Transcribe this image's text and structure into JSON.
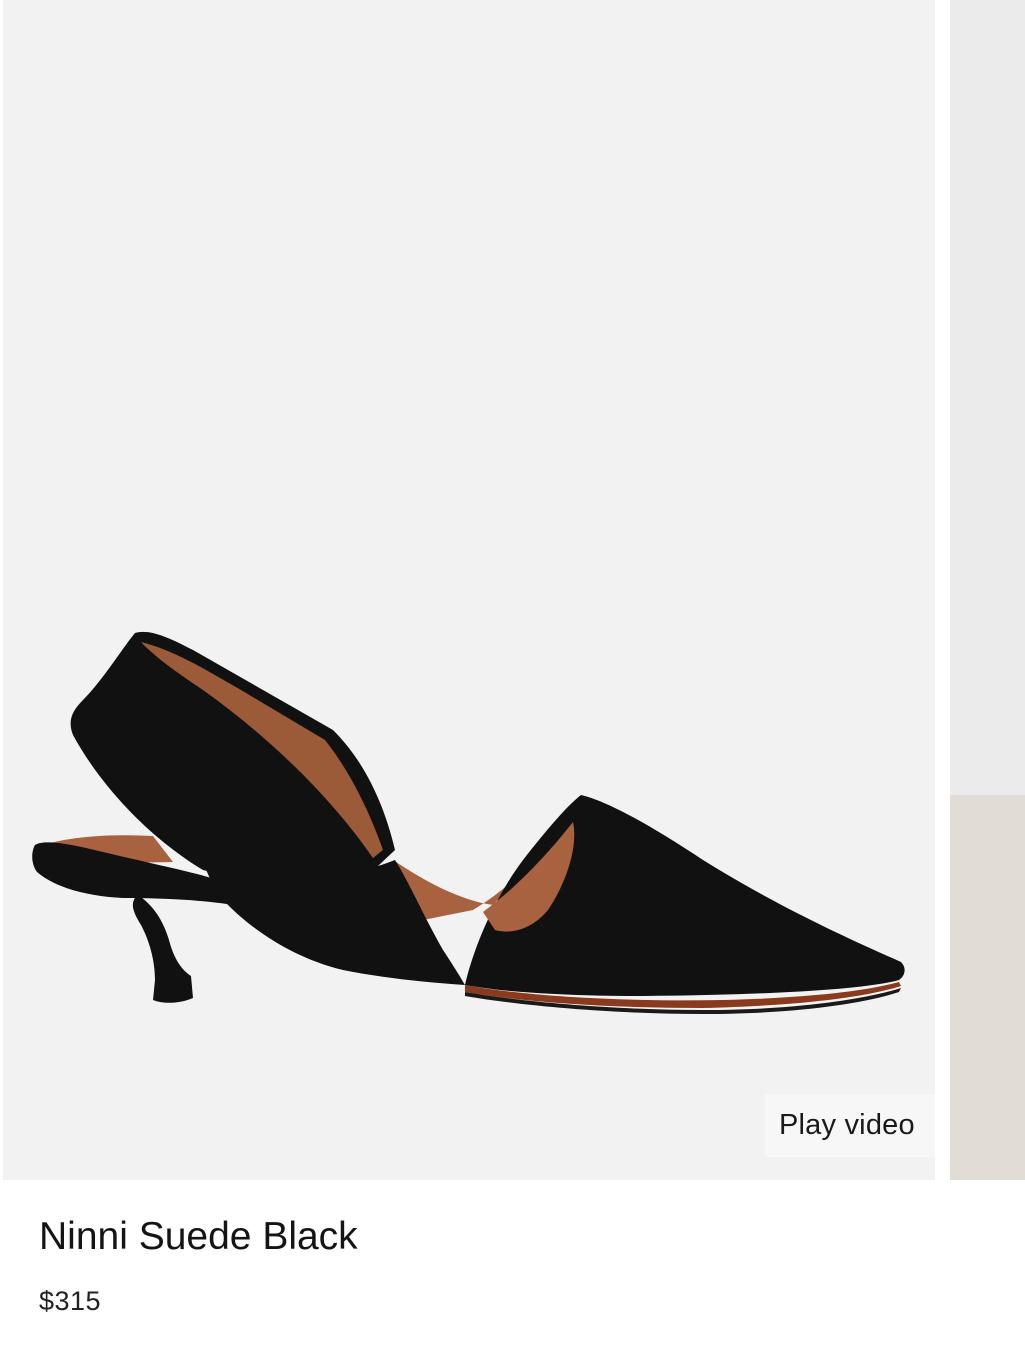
{
  "product": {
    "name": "Ninni Suede Black",
    "price": "$315"
  },
  "video_button": {
    "label": "Play video",
    "icon": "play-circle-icon"
  },
  "colors": {
    "image_background": "#f2f2f2",
    "suede": "#111111",
    "lining": "#a8623f",
    "text": "#141414"
  }
}
